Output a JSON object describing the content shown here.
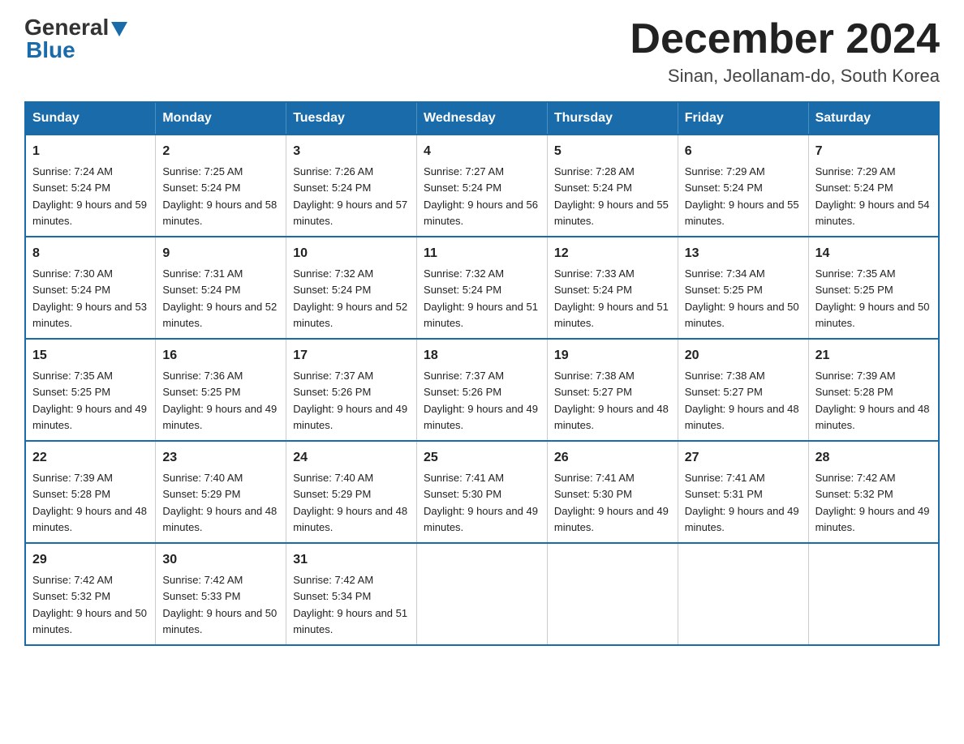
{
  "header": {
    "logo_general": "General",
    "logo_blue": "Blue",
    "month_year": "December 2024",
    "location": "Sinan, Jeollanam-do, South Korea"
  },
  "days_of_week": [
    "Sunday",
    "Monday",
    "Tuesday",
    "Wednesday",
    "Thursday",
    "Friday",
    "Saturday"
  ],
  "weeks": [
    [
      {
        "day": "1",
        "sunrise": "7:24 AM",
        "sunset": "5:24 PM",
        "daylight": "9 hours and 59 minutes."
      },
      {
        "day": "2",
        "sunrise": "7:25 AM",
        "sunset": "5:24 PM",
        "daylight": "9 hours and 58 minutes."
      },
      {
        "day": "3",
        "sunrise": "7:26 AM",
        "sunset": "5:24 PM",
        "daylight": "9 hours and 57 minutes."
      },
      {
        "day": "4",
        "sunrise": "7:27 AM",
        "sunset": "5:24 PM",
        "daylight": "9 hours and 56 minutes."
      },
      {
        "day": "5",
        "sunrise": "7:28 AM",
        "sunset": "5:24 PM",
        "daylight": "9 hours and 55 minutes."
      },
      {
        "day": "6",
        "sunrise": "7:29 AM",
        "sunset": "5:24 PM",
        "daylight": "9 hours and 55 minutes."
      },
      {
        "day": "7",
        "sunrise": "7:29 AM",
        "sunset": "5:24 PM",
        "daylight": "9 hours and 54 minutes."
      }
    ],
    [
      {
        "day": "8",
        "sunrise": "7:30 AM",
        "sunset": "5:24 PM",
        "daylight": "9 hours and 53 minutes."
      },
      {
        "day": "9",
        "sunrise": "7:31 AM",
        "sunset": "5:24 PM",
        "daylight": "9 hours and 52 minutes."
      },
      {
        "day": "10",
        "sunrise": "7:32 AM",
        "sunset": "5:24 PM",
        "daylight": "9 hours and 52 minutes."
      },
      {
        "day": "11",
        "sunrise": "7:32 AM",
        "sunset": "5:24 PM",
        "daylight": "9 hours and 51 minutes."
      },
      {
        "day": "12",
        "sunrise": "7:33 AM",
        "sunset": "5:24 PM",
        "daylight": "9 hours and 51 minutes."
      },
      {
        "day": "13",
        "sunrise": "7:34 AM",
        "sunset": "5:25 PM",
        "daylight": "9 hours and 50 minutes."
      },
      {
        "day": "14",
        "sunrise": "7:35 AM",
        "sunset": "5:25 PM",
        "daylight": "9 hours and 50 minutes."
      }
    ],
    [
      {
        "day": "15",
        "sunrise": "7:35 AM",
        "sunset": "5:25 PM",
        "daylight": "9 hours and 49 minutes."
      },
      {
        "day": "16",
        "sunrise": "7:36 AM",
        "sunset": "5:25 PM",
        "daylight": "9 hours and 49 minutes."
      },
      {
        "day": "17",
        "sunrise": "7:37 AM",
        "sunset": "5:26 PM",
        "daylight": "9 hours and 49 minutes."
      },
      {
        "day": "18",
        "sunrise": "7:37 AM",
        "sunset": "5:26 PM",
        "daylight": "9 hours and 49 minutes."
      },
      {
        "day": "19",
        "sunrise": "7:38 AM",
        "sunset": "5:27 PM",
        "daylight": "9 hours and 48 minutes."
      },
      {
        "day": "20",
        "sunrise": "7:38 AM",
        "sunset": "5:27 PM",
        "daylight": "9 hours and 48 minutes."
      },
      {
        "day": "21",
        "sunrise": "7:39 AM",
        "sunset": "5:28 PM",
        "daylight": "9 hours and 48 minutes."
      }
    ],
    [
      {
        "day": "22",
        "sunrise": "7:39 AM",
        "sunset": "5:28 PM",
        "daylight": "9 hours and 48 minutes."
      },
      {
        "day": "23",
        "sunrise": "7:40 AM",
        "sunset": "5:29 PM",
        "daylight": "9 hours and 48 minutes."
      },
      {
        "day": "24",
        "sunrise": "7:40 AM",
        "sunset": "5:29 PM",
        "daylight": "9 hours and 48 minutes."
      },
      {
        "day": "25",
        "sunrise": "7:41 AM",
        "sunset": "5:30 PM",
        "daylight": "9 hours and 49 minutes."
      },
      {
        "day": "26",
        "sunrise": "7:41 AM",
        "sunset": "5:30 PM",
        "daylight": "9 hours and 49 minutes."
      },
      {
        "day": "27",
        "sunrise": "7:41 AM",
        "sunset": "5:31 PM",
        "daylight": "9 hours and 49 minutes."
      },
      {
        "day": "28",
        "sunrise": "7:42 AM",
        "sunset": "5:32 PM",
        "daylight": "9 hours and 49 minutes."
      }
    ],
    [
      {
        "day": "29",
        "sunrise": "7:42 AM",
        "sunset": "5:32 PM",
        "daylight": "9 hours and 50 minutes."
      },
      {
        "day": "30",
        "sunrise": "7:42 AM",
        "sunset": "5:33 PM",
        "daylight": "9 hours and 50 minutes."
      },
      {
        "day": "31",
        "sunrise": "7:42 AM",
        "sunset": "5:34 PM",
        "daylight": "9 hours and 51 minutes."
      },
      null,
      null,
      null,
      null
    ]
  ]
}
